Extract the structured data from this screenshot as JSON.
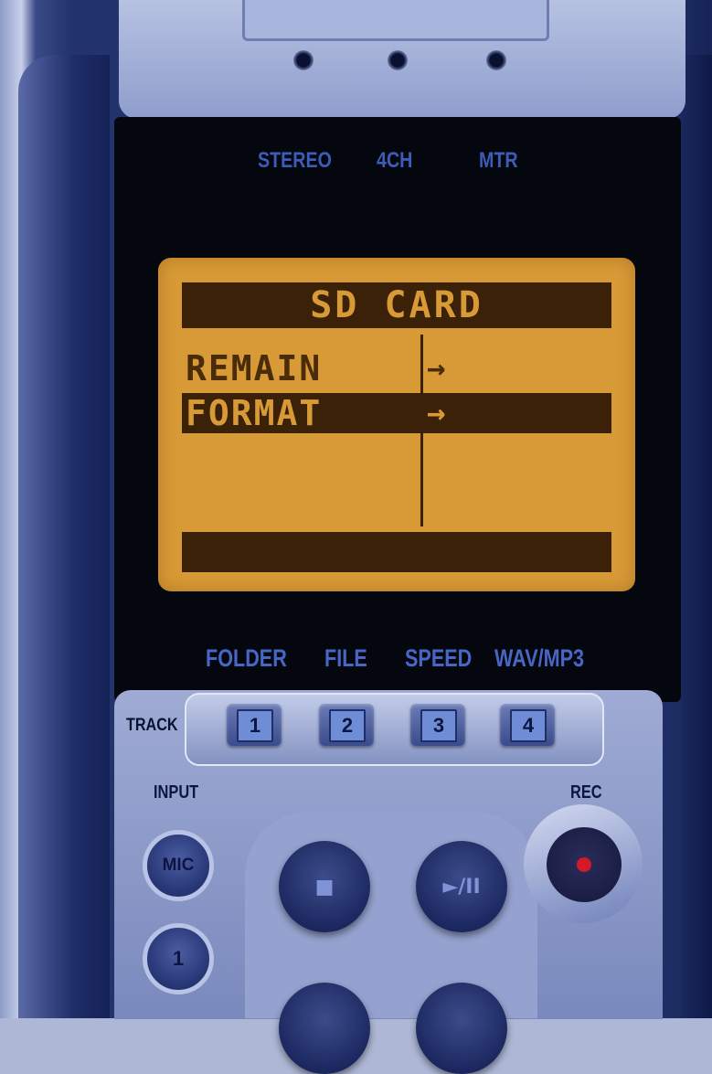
{
  "mode_selector": {
    "labels": [
      "STEREO",
      "4CH",
      "MTR"
    ]
  },
  "lcd": {
    "title": "SD CARD",
    "menu_items": [
      {
        "label": "REMAIN",
        "arrow": "→",
        "selected": false
      },
      {
        "label": "FORMAT",
        "arrow": "→",
        "selected": true
      }
    ]
  },
  "function_labels": [
    "FOLDER",
    "FILE",
    "SPEED",
    "WAV/MP3"
  ],
  "track": {
    "label": "TRACK",
    "buttons": [
      "1",
      "2",
      "3",
      "4"
    ]
  },
  "input": {
    "label": "INPUT",
    "mic_label": "MIC",
    "ch1_label": "1"
  },
  "transport": {
    "stop_symbol": "■",
    "play_pause_symbol": "►/II"
  },
  "rec": {
    "label": "REC"
  },
  "colors": {
    "lcd_backlight": "#d79a36",
    "lcd_ink": "#3a2108",
    "label_blue": "#4767c6",
    "rec_red": "#d41a28"
  }
}
